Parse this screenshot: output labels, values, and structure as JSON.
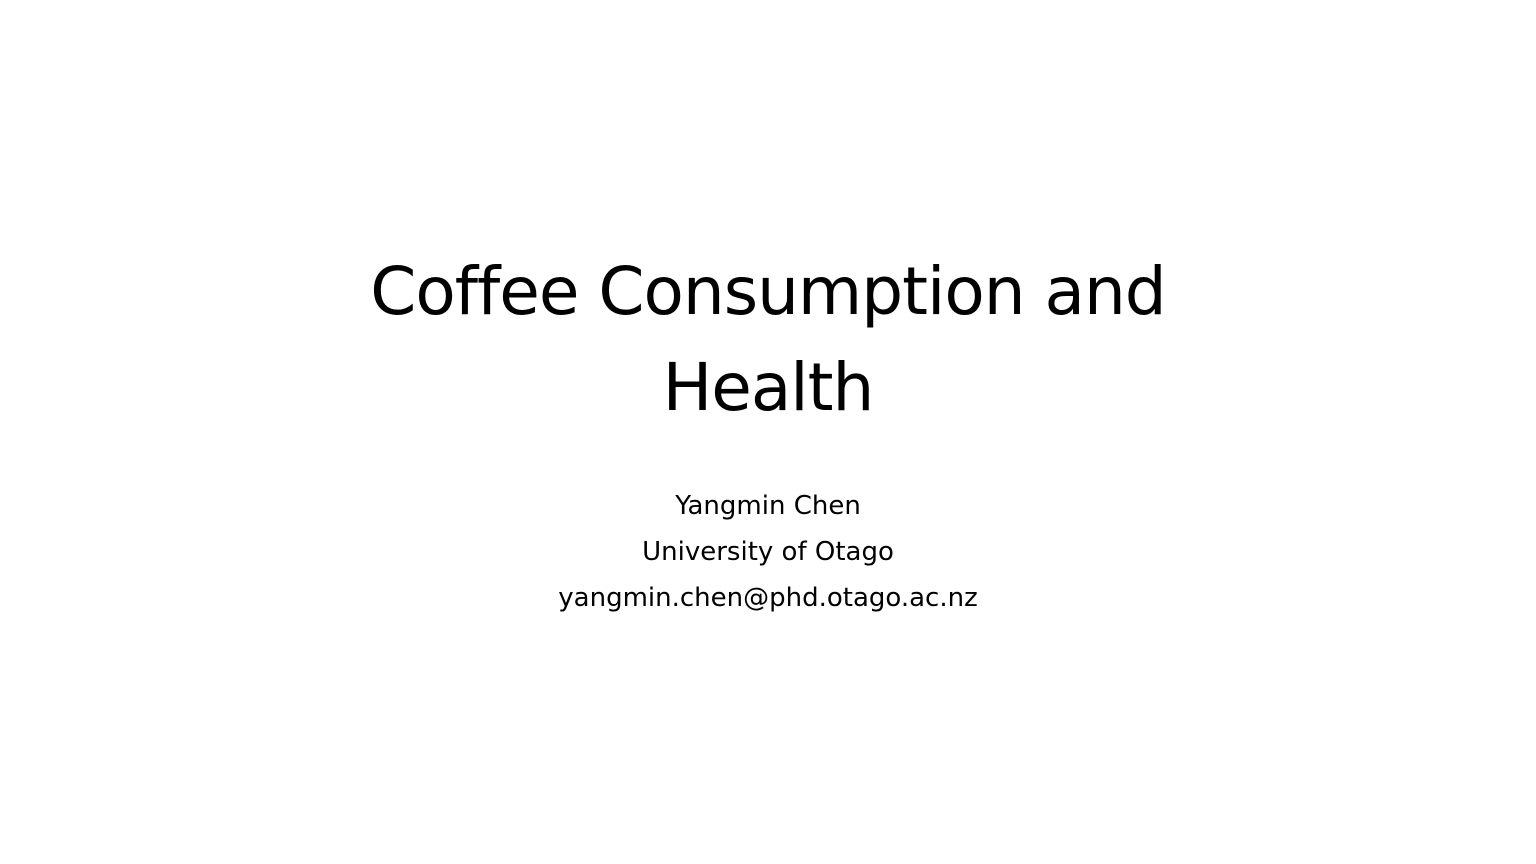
{
  "slide": {
    "title_lines": [
      "Coffee Consumption and",
      "Health"
    ],
    "subtitle_lines": [
      "Yangmin Chen",
      "University of Otago",
      "yangmin.chen@phd.otago.ac.nz"
    ]
  }
}
